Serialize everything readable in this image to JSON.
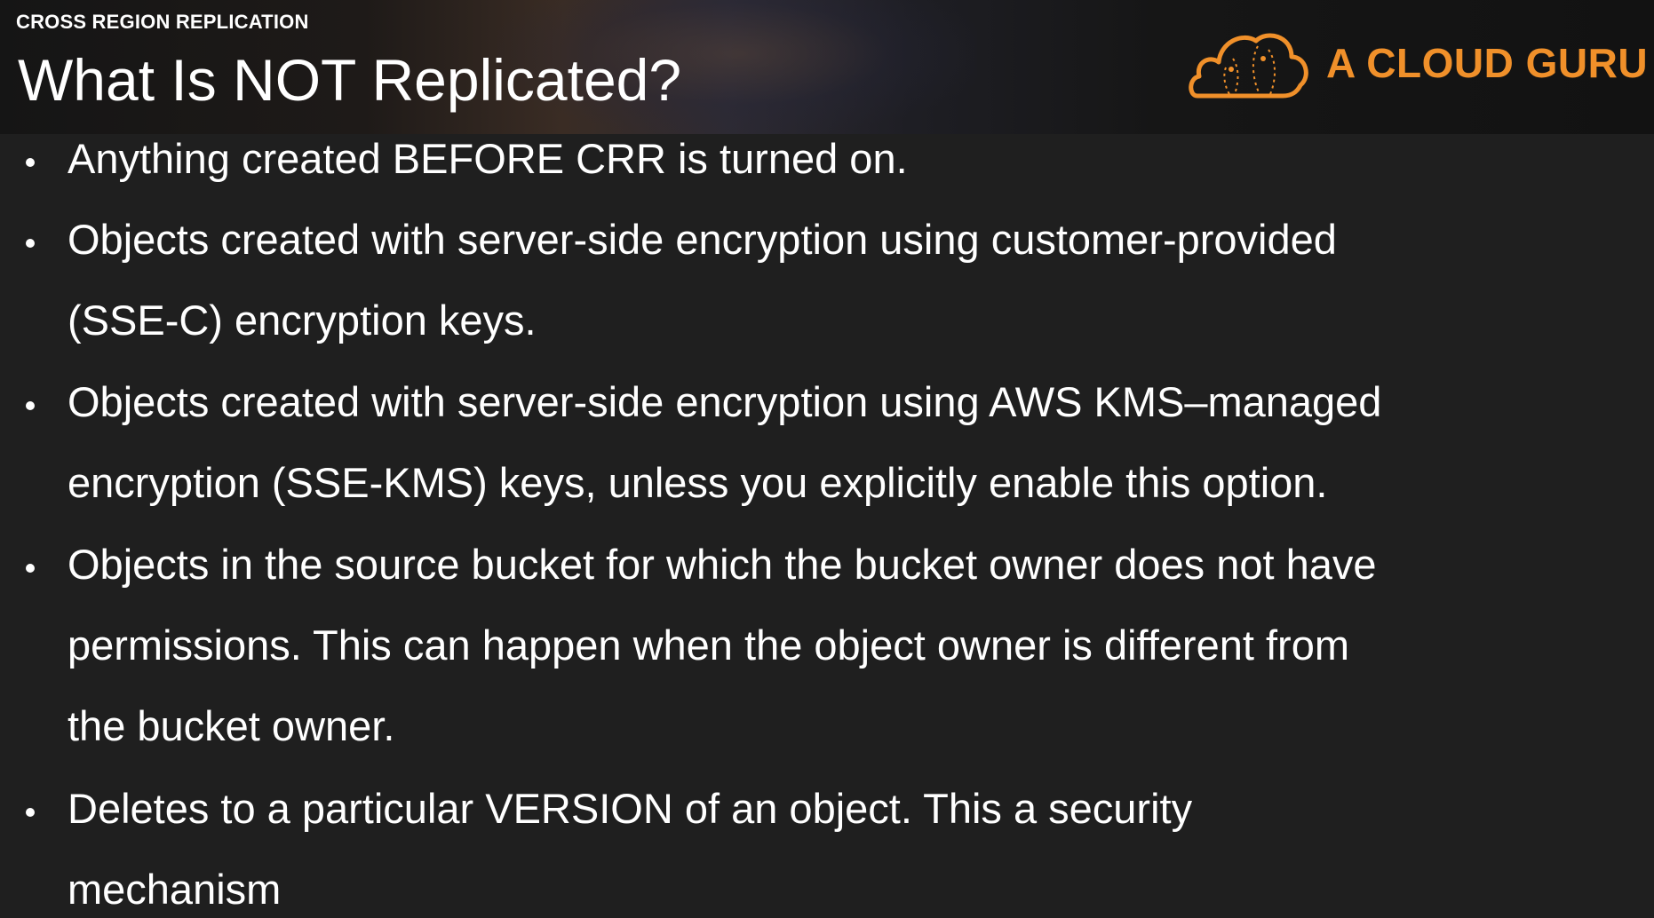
{
  "header": {
    "section_label": "CROSS REGION REPLICATION",
    "title": "What Is NOT Replicated?",
    "brand_text": "A CLOUD GURU",
    "brand_color": "#f0902a",
    "logo_icon": "cloud-icon"
  },
  "bullets": [
    {
      "lines": [
        "Anything created BEFORE CRR is turned on."
      ]
    },
    {
      "lines": [
        "Objects created with server-side encryption using customer-provided",
        "(SSE-C) encryption keys."
      ]
    },
    {
      "lines": [
        "Objects created with server-side encryption using AWS KMS–managed",
        "encryption (SSE-KMS) keys, unless you explicitly enable this option."
      ]
    },
    {
      "lines": [
        "Objects in the source bucket for which the bucket owner does not have",
        "permissions. This can happen when the object owner is different from",
        "the bucket owner."
      ]
    },
    {
      "lines": [
        "Deletes to a particular VERSION of an object. This a security",
        "mechanism"
      ]
    }
  ]
}
